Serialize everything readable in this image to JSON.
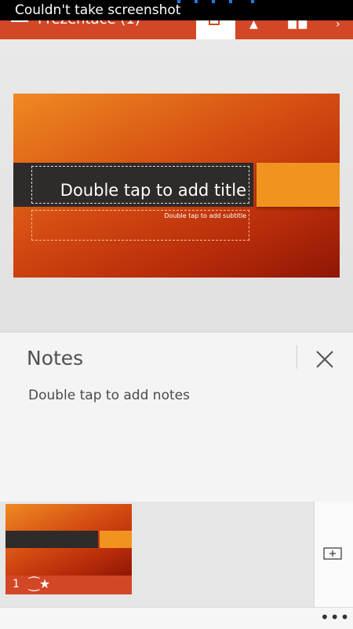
{
  "status_bar": {
    "toast": "Couldn't take screenshot"
  },
  "header": {
    "doc_title": "Prezentace (1)"
  },
  "slide": {
    "title_placeholder": "Double tap to add title",
    "subtitle_placeholder": "Double tap to add subtitle"
  },
  "notes": {
    "heading": "Notes",
    "placeholder": "Double tap to add notes"
  },
  "thumbnails": [
    {
      "number": "1",
      "icon": "transition-star-icon"
    }
  ],
  "bottom_bar": {
    "more": "•••"
  },
  "colors": {
    "accent": "#d24726",
    "slide_orange": "#f0941f",
    "slide_band": "#2e2b28"
  }
}
